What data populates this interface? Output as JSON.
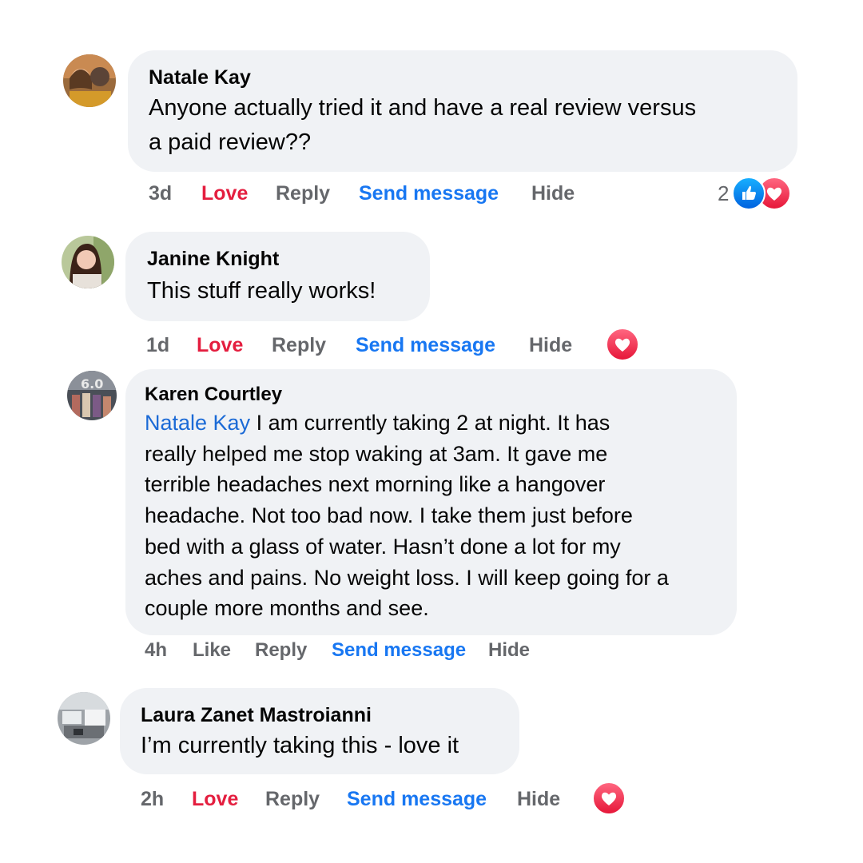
{
  "comments": [
    {
      "author": "Natale Kay",
      "text_lines": [
        "Anyone actually tried it and have a real review versus",
        "a paid review??"
      ],
      "time": "3d",
      "react_action": "Love",
      "reply": "Reply",
      "send": "Send message",
      "hide": "Hide",
      "reaction_count": "2",
      "reactions": [
        "thumbs-up-icon",
        "heart-icon"
      ]
    },
    {
      "author": "Janine Knight",
      "text_lines": [
        "This stuff really works!"
      ],
      "time": "1d",
      "react_action": "Love",
      "reply": "Reply",
      "send": "Send message",
      "hide": "Hide",
      "reactions": [
        "heart-icon"
      ]
    },
    {
      "author": "Karen Courtley",
      "mention": "Natale Kay",
      "text_first_rest": " I am currently taking 2 at night. It has",
      "text_lines": [
        "really helped me stop waking at 3am. It gave me",
        "terrible headaches next morning like a hangover",
        "headache. Not too bad now. I take them just before",
        "bed with a glass of water. Hasn’t done a lot for my",
        "aches and pains. No weight loss. I will keep going for a",
        "couple more months and see."
      ],
      "time": "4h",
      "react_action": "Like",
      "reply": "Reply",
      "send": "Send message",
      "hide": "Hide"
    },
    {
      "author": "Laura Zanet Mastroianni",
      "text_lines": [
        "I’m currently taking this - love it"
      ],
      "time": "2h",
      "react_action": "Love",
      "reply": "Reply",
      "send": "Send message",
      "hide": "Hide",
      "reactions": [
        "heart-icon"
      ]
    }
  ],
  "colors": {
    "bubble": "#f0f2f5",
    "love": "#e41e3f",
    "link": "#1877f2",
    "muted": "#65676b"
  }
}
